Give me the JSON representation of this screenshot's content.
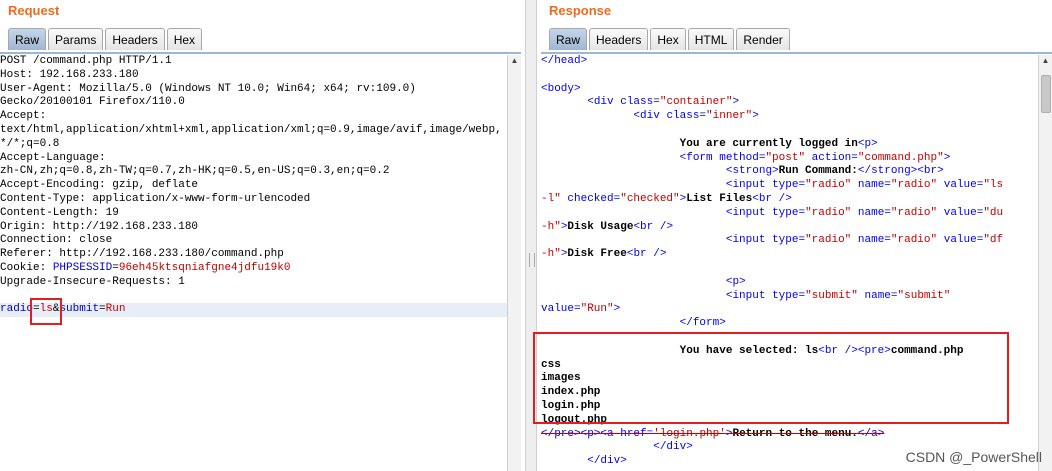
{
  "request": {
    "title": "Request",
    "tabs": [
      "Raw",
      "Params",
      "Headers",
      "Hex"
    ],
    "active_tab": "Raw",
    "lines": [
      "POST /command.php HTTP/1.1",
      "Host: 192.168.233.180",
      "User-Agent: Mozilla/5.0 (Windows NT 10.0; Win64; x64; rv:109.0)",
      "Gecko/20100101 Firefox/110.0",
      "Accept:",
      "text/html,application/xhtml+xml,application/xml;q=0.9,image/avif,image/webp,",
      "*/*;q=0.8",
      "Accept-Language:",
      "zh-CN,zh;q=0.8,zh-TW;q=0.7,zh-HK;q=0.5,en-US;q=0.3,en;q=0.2",
      "Accept-Encoding: gzip, deflate",
      "Content-Type: application/x-www-form-urlencoded",
      "Content-Length: 19",
      "Origin: http://192.168.233.180",
      "Connection: close",
      "Referer: http://192.168.233.180/command.php"
    ],
    "cookie_label": "Cookie: ",
    "cookie_name": "PHPSESSID",
    "cookie_eq": "=",
    "cookie_value": "96eh45ktsqniafgne4jdfu19k0",
    "upgrade_line": "Upgrade-Insecure-Requests: 1",
    "body": {
      "p1_name": "radio",
      "p1_eq": "=",
      "p1_value": "ls",
      "amp": "&",
      "p2_name": "submit",
      "p2_eq": "=",
      "p2_value": "Run"
    }
  },
  "response": {
    "title": "Response",
    "tabs": [
      "Raw",
      "Headers",
      "Hex",
      "HTML",
      "Render"
    ],
    "active_tab": "Raw",
    "l1": "</head>",
    "l3": "<body>",
    "l4a": "<div ",
    "l4b": "class=",
    "l4c": "\"container\"",
    "l4d": ">",
    "l5a": "<div ",
    "l5b": "class=",
    "l5c": "\"inner\"",
    "l5d": ">",
    "l7a": "You are currently logged in",
    "l7b": "<p>",
    "l8a": "<form ",
    "l8b": "method=",
    "l8c": "\"post\" ",
    "l8d": "action=",
    "l8e": "\"command.php\"",
    "l8f": ">",
    "l9a": "<strong>",
    "l9b": "Run Command:",
    "l9c": "</strong>",
    "l9d": "<br>",
    "l10a": "<input ",
    "l10b": "type=",
    "l10c": "\"radio\" ",
    "l10d": "name=",
    "l10e": "\"radio\" ",
    "l10f": "value=",
    "l10g": "\"ls",
    "l11a": "-l\" ",
    "l11b": "checked=",
    "l11c": "\"checked\"",
    "l11d": ">",
    "l11e": "List Files",
    "l11f": "<br />",
    "l12a": "<input ",
    "l12b": "type=",
    "l12c": "\"radio\" ",
    "l12d": "name=",
    "l12e": "\"radio\" ",
    "l12f": "value=",
    "l12g": "\"du",
    "l13a": "-h\"",
    "l13b": ">",
    "l13c": "Disk Usage",
    "l13d": "<br />",
    "l14a": "<input ",
    "l14b": "type=",
    "l14c": "\"radio\" ",
    "l14d": "name=",
    "l14e": "\"radio\" ",
    "l14f": "value=",
    "l14g": "\"df",
    "l15a": "-h\"",
    "l15b": ">",
    "l15c": "Disk Free",
    "l15d": "<br />",
    "l16": "<p>",
    "l17a": "<input ",
    "l17b": "type=",
    "l17c": "\"submit\" ",
    "l17d": "name=",
    "l17e": "\"submit\"",
    "l18a": "value=",
    "l18b": "\"Run\"",
    "l18c": ">",
    "l19": "</form>",
    "l21a": "You have selected: ls",
    "l21b": "<br />",
    "l21c": "<pre>",
    "l21d": "command.php",
    "l22": "css",
    "l23": "images",
    "l24": "index.php",
    "l25": "login.php",
    "l26": "logout.php",
    "l27a": "</pre>",
    "l27b": "<p>",
    "l27c": "<a ",
    "l27d": "href=",
    "l27e": "'login.php'",
    "l27f": ">",
    "l27g": "Return to the menu.",
    "l27h": "</a>",
    "l28": "</div>",
    "l29": "</div>"
  },
  "watermark": "CSDN @_PowerShell"
}
